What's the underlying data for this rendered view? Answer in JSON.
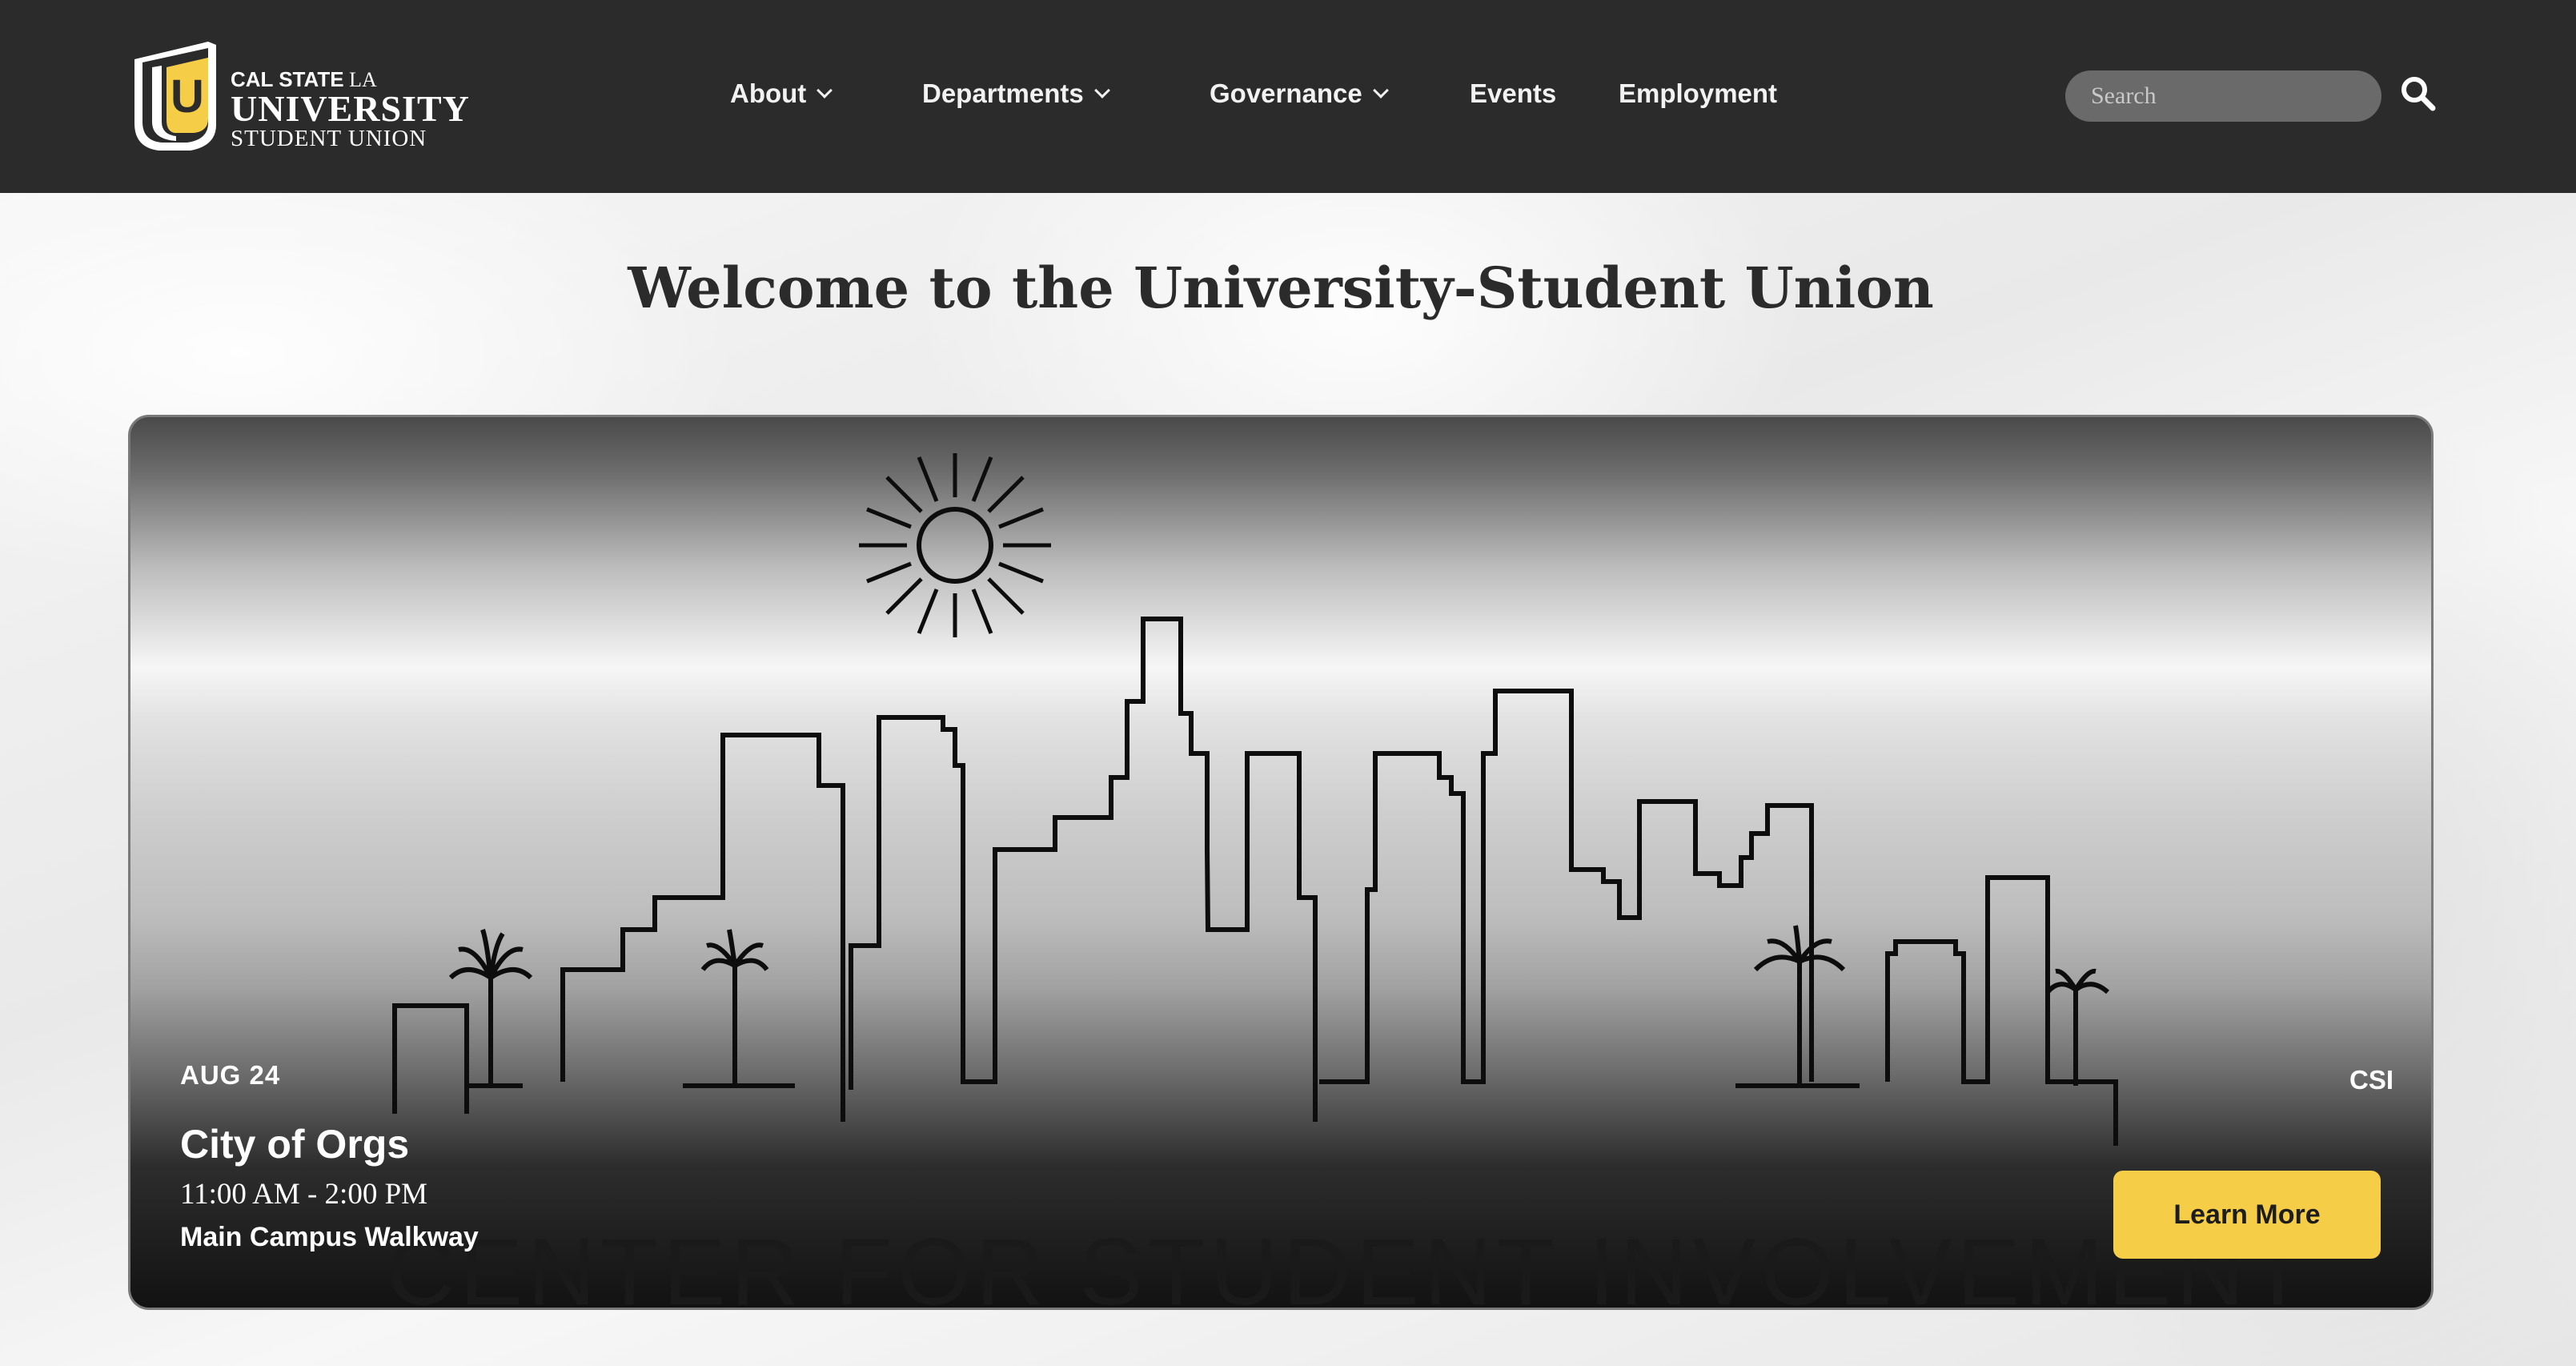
{
  "header": {
    "logo": {
      "line1_a": "CAL STATE",
      "line1_b": " LA",
      "line2": "UNIVERSITY",
      "line3": "STUDENT UNION",
      "monogram": "U"
    },
    "nav": [
      {
        "label": "About",
        "dropdown": true
      },
      {
        "label": "Departments",
        "dropdown": true
      },
      {
        "label": "Governance",
        "dropdown": true
      },
      {
        "label": "Events",
        "dropdown": false
      },
      {
        "label": "Employment",
        "dropdown": false
      }
    ],
    "search": {
      "placeholder": "Search",
      "icon": "search-icon"
    }
  },
  "main": {
    "title": "Welcome to the University-Student Union",
    "hero": {
      "date": "AUG 24",
      "event_title": "City of Orgs",
      "time": "11:00 AM - 2:00 PM",
      "location": "Main Campus Walkway",
      "tag": "CSI",
      "button_label": "Learn More",
      "caption": "CENTER FOR STUDENT INVOLVEMENT"
    }
  },
  "colors": {
    "header_bg": "#2b2b2b",
    "accent_gold": "#f5cd47",
    "title_text": "#2b2b2b"
  }
}
